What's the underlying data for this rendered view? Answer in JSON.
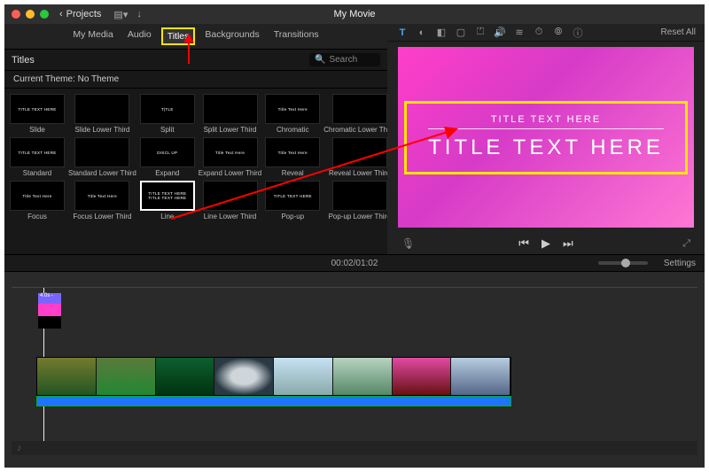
{
  "window": {
    "projects_label": "Projects",
    "title": "My Movie"
  },
  "media_tabs": {
    "my_media": "My Media",
    "audio": "Audio",
    "titles": "Titles",
    "backgrounds": "Backgrounds",
    "transitions": "Transitions"
  },
  "browser": {
    "heading": "Titles",
    "search_placeholder": "Search",
    "theme_label": "Current Theme: No Theme"
  },
  "thumbs": [
    {
      "preview": "TITLE TEXT HERE",
      "caption": "Slide"
    },
    {
      "preview": "",
      "caption": "Slide Lower Third"
    },
    {
      "preview": "T|TLE",
      "caption": "Split"
    },
    {
      "preview": "",
      "caption": "Split Lower Third"
    },
    {
      "preview": "Title Text Here",
      "caption": "Chromatic"
    },
    {
      "preview": "",
      "caption": "Chromatic Lower Third"
    },
    {
      "preview": "TITLE TEXT HERE",
      "caption": "Standard"
    },
    {
      "preview": "",
      "caption": "Standard Lower Third"
    },
    {
      "preview": "DISCL UP",
      "caption": "Expand"
    },
    {
      "preview": "Title Text Here",
      "caption": "Expand Lower Third"
    },
    {
      "preview": "Title Text Here",
      "caption": "Reveal"
    },
    {
      "preview": "",
      "caption": "Reveal Lower Third"
    },
    {
      "preview": "Title Text Here",
      "caption": "Focus"
    },
    {
      "preview": "Title Text Here",
      "caption": "Focus Lower Third"
    },
    {
      "preview": "TITLE TEXT HERE\nTITLE TEXT HERE",
      "caption": "Line",
      "selected": true
    },
    {
      "preview": "",
      "caption": "Line Lower Third"
    },
    {
      "preview": "TITLE TEXT HERE",
      "caption": "Pop-up"
    },
    {
      "preview": "",
      "caption": "Pop-up Lower Third"
    }
  ],
  "viewer": {
    "reset": "Reset All",
    "title_sub": "TITLE TEXT HERE",
    "title_main": "TITLE TEXT HERE"
  },
  "timecode": {
    "current": "00:02",
    "sep": " / ",
    "total": "01:02",
    "settings": "Settings"
  },
  "timeline": {
    "title_clip_label": "4.0s -"
  }
}
